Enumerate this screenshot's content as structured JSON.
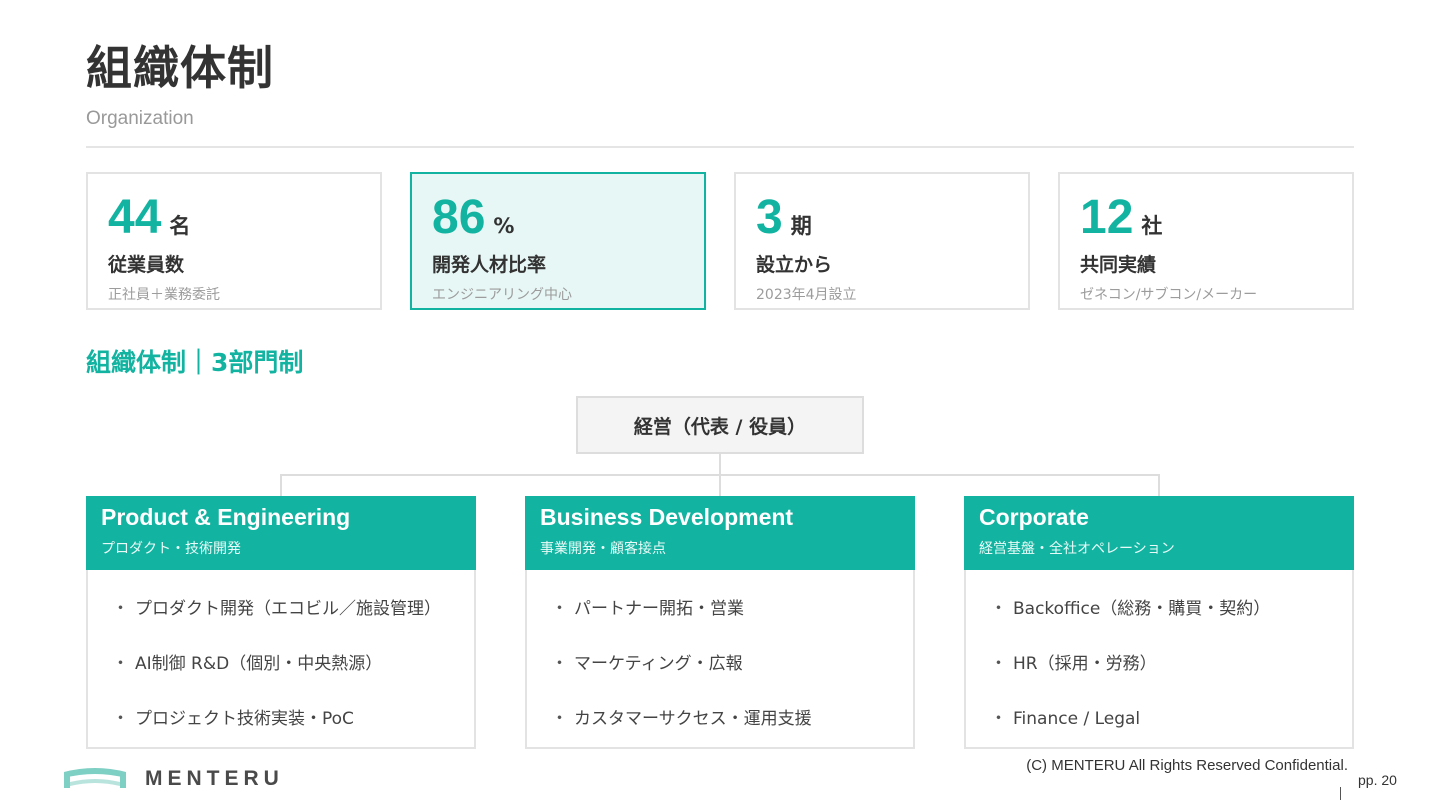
{
  "header": {
    "title": "組織体制",
    "subtitle": "Organization"
  },
  "kpis": [
    {
      "value": "44",
      "unit": "名",
      "label": "従業員数",
      "note": "正社員＋業務委託",
      "highlight": false
    },
    {
      "value": "86",
      "unit": "%",
      "label": "開発人材比率",
      "note": "エンジニアリング中心",
      "highlight": true
    },
    {
      "value": "3",
      "unit": "期",
      "label": "設立から",
      "note": "2023年4月設立",
      "highlight": false
    },
    {
      "value": "12",
      "unit": "社",
      "label": "共同実績",
      "note": "ゼネコン/サブコン/メーカー",
      "highlight": false
    }
  ],
  "section_title": "組織体制｜3部門制",
  "org": {
    "top": "経営（代表 / 役員）",
    "departments": [
      {
        "name": "Product & Engineering",
        "desc": "プロダクト・技術開発",
        "items": [
          "プロダクト開発（エコビル／施設管理）",
          "AI制御 R&D（個別・中央熱源）",
          "プロジェクト技術実装・PoC"
        ]
      },
      {
        "name": "Business Development",
        "desc": "事業開発・顧客接点",
        "items": [
          "パートナー開拓・営業",
          "マーケティング・広報",
          "カスタマーサクセス・運用支援"
        ]
      },
      {
        "name": "Corporate",
        "desc": "経営基盤・全社オペレーション",
        "items": [
          "Backoffice（総務・購買・契約）",
          "HR（採用・労務）",
          "Finance / Legal"
        ]
      }
    ]
  },
  "footer": {
    "logo_text": "MENTERU",
    "copyright": "(C) MENTERU All Rights Reserved Confidential.",
    "page": "pp. 20"
  },
  "colors": {
    "accent": "#12b3a0",
    "highlight_bg": "#e7f7f5",
    "text": "#333333",
    "muted": "#999999"
  }
}
